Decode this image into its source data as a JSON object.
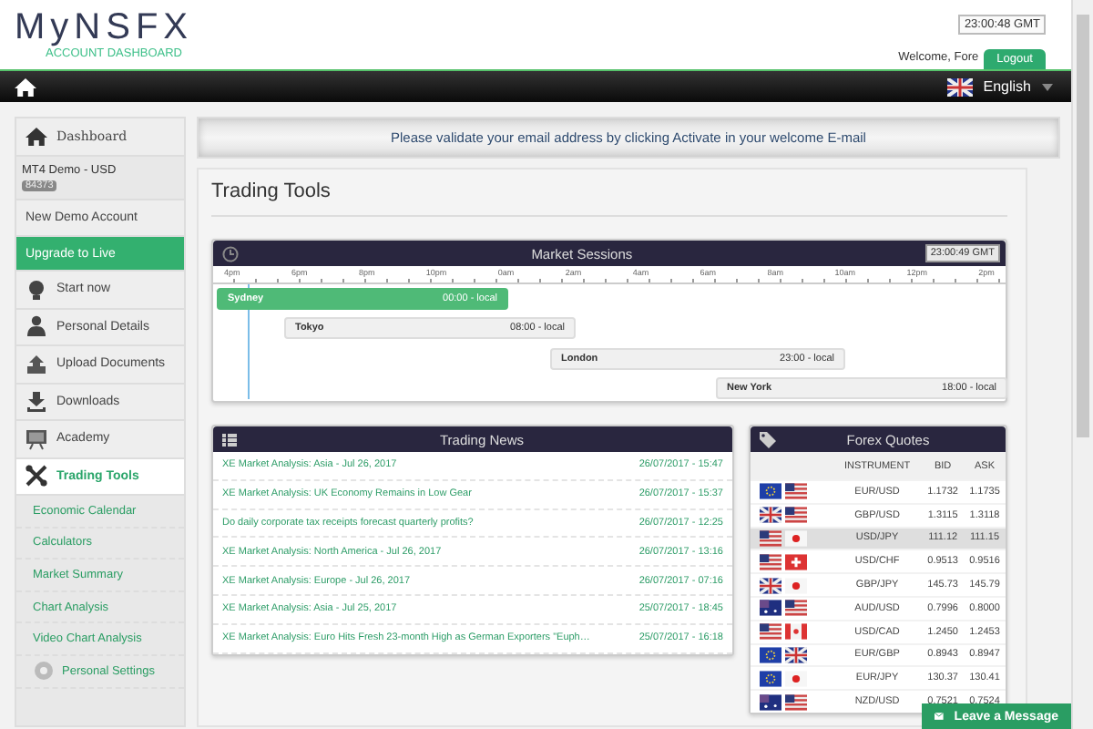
{
  "header": {
    "logo": "MyNSFX",
    "subtitle": "ACCOUNT DASHBOARD",
    "clock": "23:00:48 GMT",
    "welcome": "Welcome, Fore",
    "logout": "Logout"
  },
  "navbar": {
    "language": "English"
  },
  "sidebar": {
    "dashboard": "Dashboard",
    "account": {
      "name": "MT4 Demo - USD",
      "number": "84373"
    },
    "items": [
      {
        "label": "New Demo Account",
        "kind": "plain",
        "selected": false
      },
      {
        "label": "Upgrade to Live",
        "kind": "highlight",
        "selected": false
      },
      {
        "label": "Start now",
        "kind": "icon",
        "selected": false
      },
      {
        "label": "Personal Details",
        "kind": "icon",
        "selected": false
      },
      {
        "label": "Upload Documents",
        "kind": "icon",
        "selected": false
      },
      {
        "label": "Downloads",
        "kind": "icon",
        "selected": false
      },
      {
        "label": "Academy",
        "kind": "icon",
        "selected": false
      },
      {
        "label": "Trading Tools",
        "kind": "icon",
        "selected": true,
        "children": [
          {
            "label": "Economic Calendar",
            "kind": "plain"
          },
          {
            "label": "Calculators",
            "kind": "plain"
          },
          {
            "label": "Market Summary",
            "kind": "plain"
          },
          {
            "label": "Chart Analysis",
            "kind": "plain"
          },
          {
            "label": "Video Chart Analysis",
            "kind": "plain"
          },
          {
            "label": "Personal Settings",
            "kind": "icon"
          }
        ]
      }
    ]
  },
  "banner": "Please validate your email address by clicking Activate in your welcome E-mail",
  "page_title": "Trading Tools",
  "market_sessions": {
    "title": "Market Sessions",
    "clock": "23:00:49 GMT",
    "axis": [
      "4pm",
      "6pm",
      "8pm",
      "10pm",
      "0am",
      "2am",
      "4am",
      "6am",
      "8am",
      "10am",
      "12pm",
      "2pm"
    ],
    "sessions": [
      {
        "name": "Sydney",
        "time": "00:00 - local",
        "open": true
      },
      {
        "name": "Tokyo",
        "time": "08:00 - local",
        "open": false
      },
      {
        "name": "London",
        "time": "23:00 - local",
        "open": false
      },
      {
        "name": "New York",
        "time": "18:00 - local",
        "open": false
      }
    ]
  },
  "trading_news": {
    "title": "Trading News",
    "items": [
      {
        "headline": "XE Market Analysis: Asia - Jul 26, 2017",
        "date": "26/07/2017 - 15:47"
      },
      {
        "headline": "XE Market Analysis: UK Economy Remains in Low Gear",
        "date": "26/07/2017 - 15:37"
      },
      {
        "headline": "Do daily corporate tax receipts forecast quarterly profits?",
        "date": "26/07/2017 - 12:25"
      },
      {
        "headline": "XE Market Analysis: North America - Jul 26, 2017",
        "date": "26/07/2017 - 13:16"
      },
      {
        "headline": "XE Market Analysis: Europe - Jul 26, 2017",
        "date": "26/07/2017 - 07:16"
      },
      {
        "headline": "XE Market Analysis: Asia - Jul 25, 2017",
        "date": "25/07/2017 - 18:45"
      },
      {
        "headline": "XE Market Analysis: Euro Hits Fresh 23-month High as German Exporters \"Euph…",
        "date": "25/07/2017 - 16:18"
      }
    ]
  },
  "forex_quotes": {
    "title": "Forex Quotes",
    "columns": [
      "INSTRUMENT",
      "BID",
      "ASK"
    ],
    "rows": [
      {
        "instrument": "EUR/USD",
        "bid": "1.1732",
        "ask": "1.1735",
        "selected": false
      },
      {
        "instrument": "GBP/USD",
        "bid": "1.3115",
        "ask": "1.3118",
        "selected": false
      },
      {
        "instrument": "USD/JPY",
        "bid": "111.12",
        "ask": "111.15",
        "selected": true
      },
      {
        "instrument": "USD/CHF",
        "bid": "0.9513",
        "ask": "0.9516",
        "selected": false
      },
      {
        "instrument": "GBP/JPY",
        "bid": "145.73",
        "ask": "145.79",
        "selected": false
      },
      {
        "instrument": "AUD/USD",
        "bid": "0.7996",
        "ask": "0.8000",
        "selected": false
      },
      {
        "instrument": "USD/CAD",
        "bid": "1.2450",
        "ask": "1.2453",
        "selected": false
      },
      {
        "instrument": "EUR/GBP",
        "bid": "0.8943",
        "ask": "0.8947",
        "selected": false
      },
      {
        "instrument": "EUR/JPY",
        "bid": "130.37",
        "ask": "130.41",
        "selected": false
      },
      {
        "instrument": "NZD/USD",
        "bid": "0.7521",
        "ask": "0.7524",
        "selected": false
      }
    ]
  },
  "chat": {
    "label": "Leave a Message"
  }
}
